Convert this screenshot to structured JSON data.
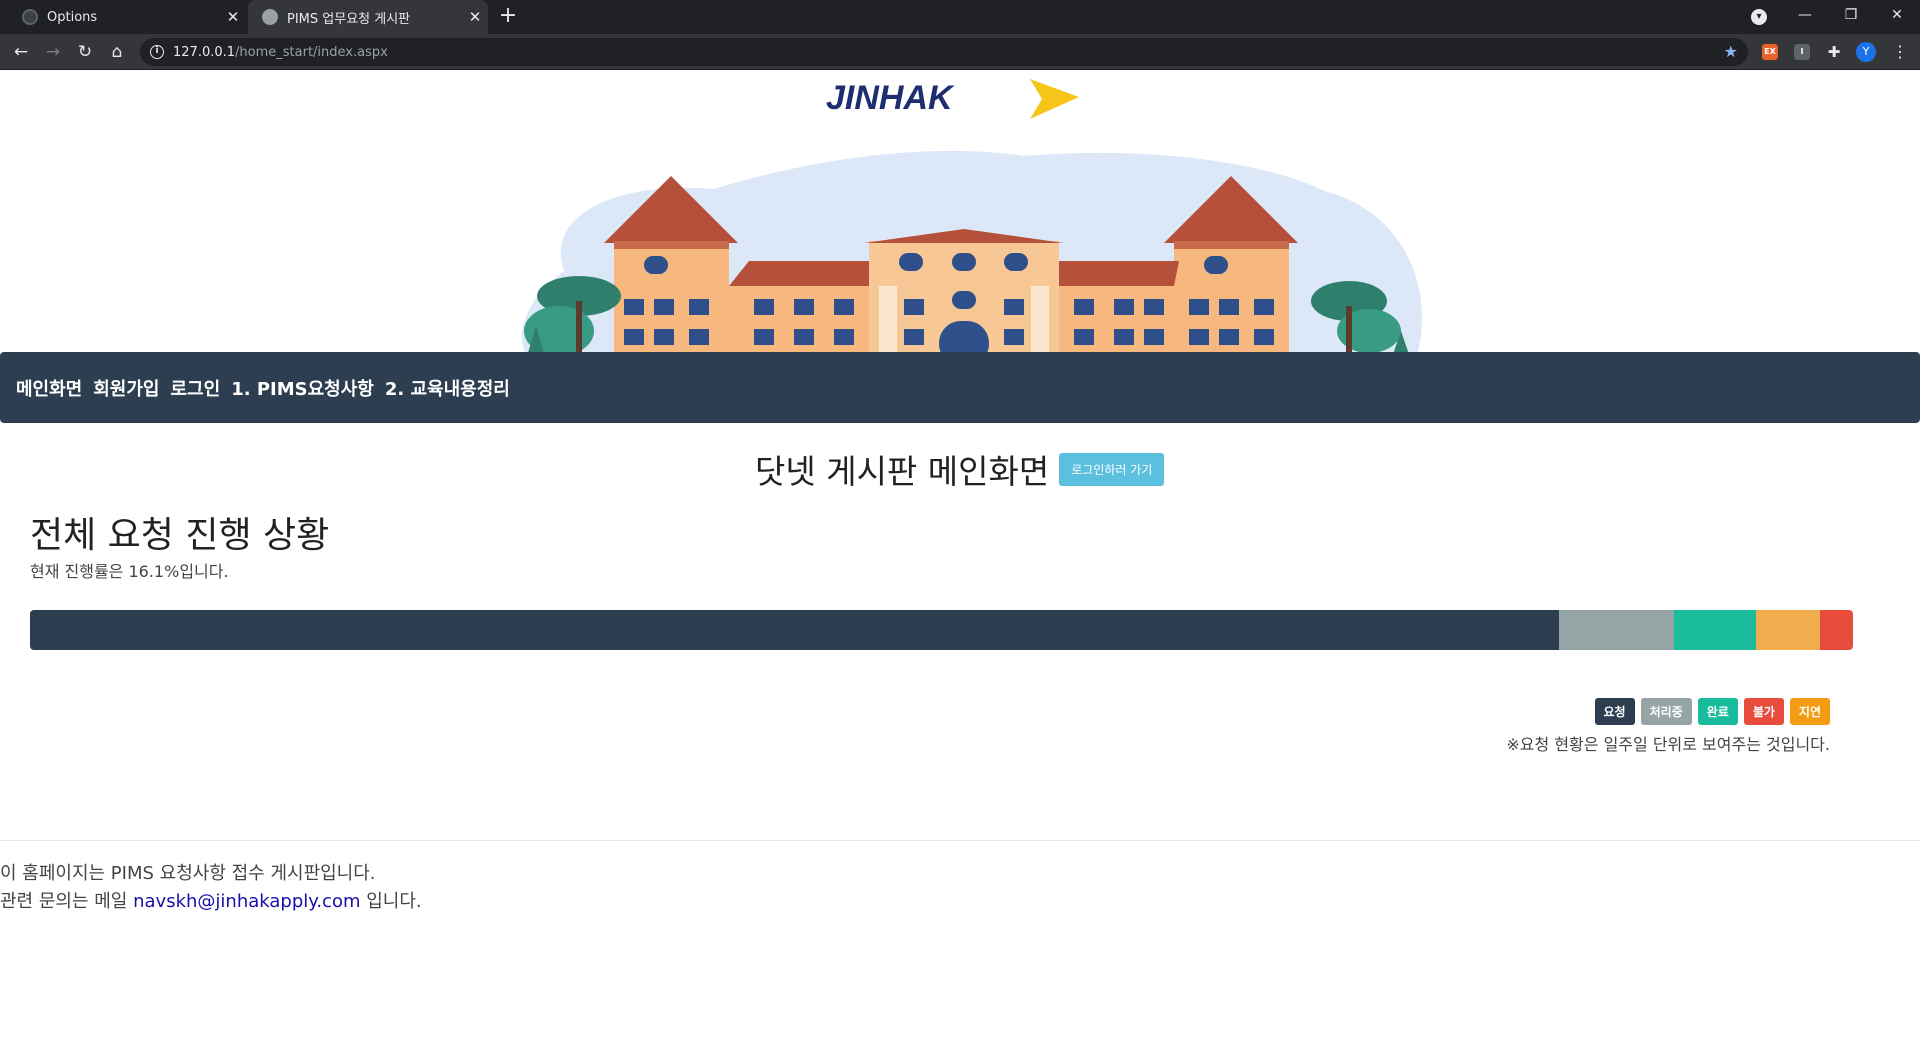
{
  "browser": {
    "tabs": [
      {
        "title": "Options",
        "active": false
      },
      {
        "title": "PIMS 업무요청 게시판",
        "active": true
      }
    ],
    "url_host": "127.0.0.1",
    "url_path": "/home_start/index.aspx",
    "profile_initial": "Y",
    "extension_labels": [
      "EX",
      "I"
    ]
  },
  "header": {
    "logo_text": "JINHAK"
  },
  "nav": {
    "items": [
      "메인화면",
      "회원가입",
      "로그인",
      "1. PIMS요청사항",
      "2. 교육내용정리"
    ]
  },
  "main": {
    "title": "닷넷 게시판 메인화면",
    "login_button": "로그인하러 가기",
    "section_title": "전체 요청 진행 상황",
    "progress_text": "현재 진행률은 16.1%입니다.",
    "progress_segments": [
      {
        "status": "요청",
        "color": "#2c3e50",
        "percent": 83.9
      },
      {
        "status": "처리중",
        "color": "#95a5a6",
        "percent": 6.3
      },
      {
        "status": "완료",
        "color": "#1abc9c",
        "percent": 4.5
      },
      {
        "status": "불가",
        "color": "#f0ad4e",
        "percent": 3.5
      },
      {
        "status": "지연",
        "color": "#e74c3c",
        "percent": 1.8
      }
    ],
    "legend": [
      {
        "label": "요청",
        "color": "#2c3e50"
      },
      {
        "label": "처리중",
        "color": "#95a5a6"
      },
      {
        "label": "완료",
        "color": "#18bc9c"
      },
      {
        "label": "불가",
        "color": "#e74c3c"
      },
      {
        "label": "지연",
        "color": "#f39c12"
      }
    ],
    "note": "※요청 현황은 일주일 단위로 보여주는 것입니다."
  },
  "footer": {
    "line1": "이 홈페이지는 PIMS 요청사항 접수 게시판입니다.",
    "line2_prefix": "관련 문의는 메일",
    "email": "navskh@jinhakapply.com",
    "line2_suffix": "입니다."
  }
}
